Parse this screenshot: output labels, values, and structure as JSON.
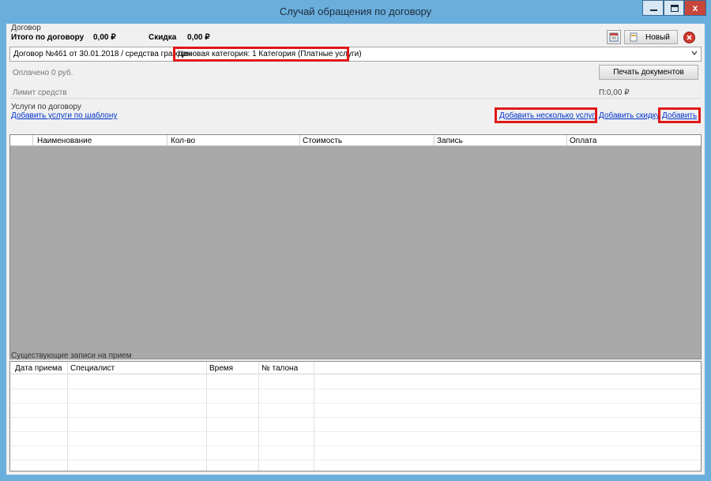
{
  "window": {
    "title": "Случай обращения по договору",
    "close_glyph": "x"
  },
  "contract": {
    "group_label": "Договор",
    "total_label": "Итого по договору",
    "total_value": "0,00 ₽",
    "discount_label": "Скидка",
    "discount_value": "0,00 ₽",
    "new_button": "Новый",
    "selected": "Договор №461 от 30.01.2018 / средства граждан",
    "price_category": "Ценовая категория: 1 Категория (Платные услуги)",
    "paid": "Оплачено 0 руб.",
    "print_button": "Печать документов",
    "limit_label": "Лимит средств",
    "limit_value": "П:0,00 ₽"
  },
  "services": {
    "group_label": "Услуги по договору",
    "add_template_link": "Добавить услуги по шаблону",
    "add_several_link": "Добавить несколько услуг",
    "add_discount_link": "Добавить скидку",
    "add_link": "Добавить",
    "columns": [
      "Наименование",
      "Кол-во",
      "Стоимость",
      "Запись",
      "Оплата"
    ]
  },
  "appointments": {
    "group_label": "Существующие записи на прием",
    "columns": [
      "Дата приема",
      "Специалист",
      "Время",
      "№ талона"
    ]
  },
  "icons": {
    "calendar": "calendar-icon",
    "new": "new-document-icon",
    "delete": "delete-icon",
    "dropdown": "chevron-down-icon"
  },
  "colors": {
    "titlebar": "#6aaedc",
    "highlight": "#e01818",
    "link": "#0033cc",
    "grid_bg": "#a9a9a9"
  }
}
